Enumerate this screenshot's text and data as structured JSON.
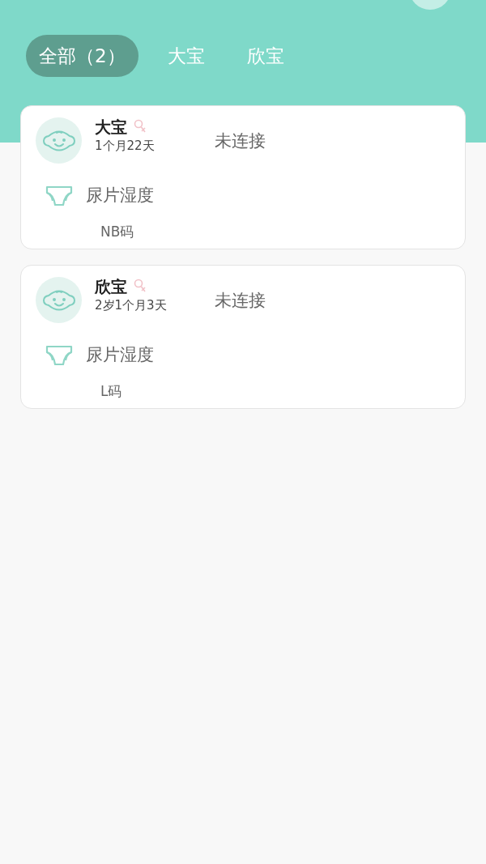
{
  "tabs": [
    {
      "label": "全部（2）",
      "selected": true
    },
    {
      "label": "大宝",
      "selected": false
    },
    {
      "label": "欣宝",
      "selected": false
    }
  ],
  "babies": [
    {
      "name": "大宝",
      "age": "1个月22天",
      "status": "未连接",
      "sensor": "尿片湿度",
      "size": "NB码"
    },
    {
      "name": "欣宝",
      "age": "2岁1个月3天",
      "status": "未连接",
      "sensor": "尿片湿度",
      "size": "L码"
    }
  ]
}
